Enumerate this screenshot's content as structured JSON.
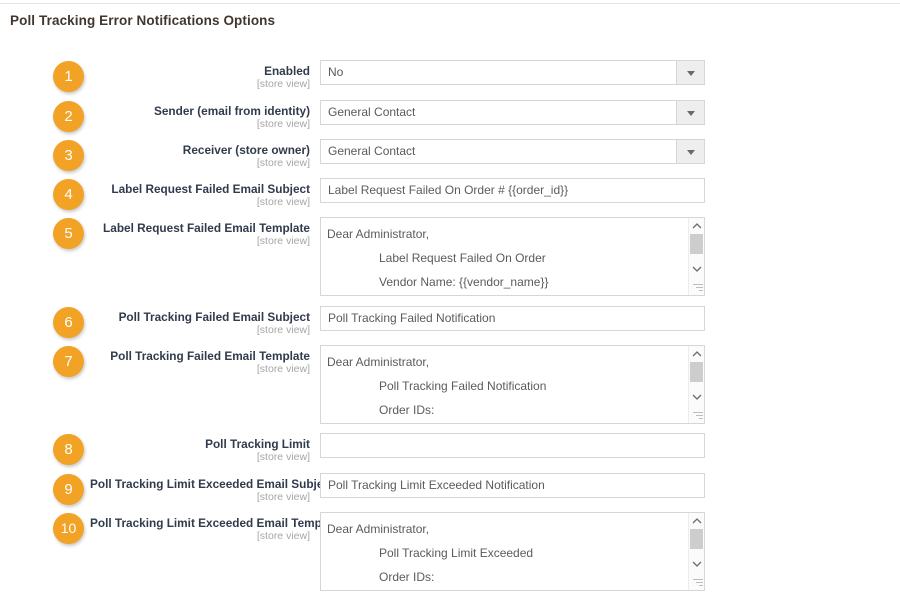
{
  "page": {
    "title": "Poll Tracking Error Notifications Options",
    "scope_label": "[store view]",
    "accent_color": "#f2a224",
    "label_color": "#303b4c",
    "border_color": "#d6d6d6"
  },
  "fields": [
    {
      "number": "1",
      "label": "Enabled",
      "scope": "[store view]",
      "type": "select",
      "value": "No"
    },
    {
      "number": "2",
      "label": "Sender (email from identity)",
      "scope": "[store view]",
      "type": "select",
      "value": "General Contact"
    },
    {
      "number": "3",
      "label": "Receiver (store owner)",
      "scope": "[store view]",
      "type": "select",
      "value": "General Contact"
    },
    {
      "number": "4",
      "label": "Label Request Failed Email Subject",
      "scope": "[store view]",
      "type": "text",
      "value": "Label Request Failed On Order # {{order_id}}"
    },
    {
      "number": "5",
      "label": "Label Request Failed Email Template",
      "scope": "[store view]",
      "type": "textarea",
      "lines": [
        "Dear Administrator,",
        "Label Request Failed On Order",
        "Vendor Name: {{vendor_name}}"
      ]
    },
    {
      "number": "6",
      "label": "Poll Tracking Failed Email Subject",
      "scope": "[store view]",
      "type": "text",
      "value": "Poll Tracking Failed Notification"
    },
    {
      "number": "7",
      "label": "Poll Tracking Failed Email Template",
      "scope": "[store view]",
      "type": "textarea",
      "lines": [
        "Dear Administrator,",
        "Poll Tracking Failed Notification",
        "Order IDs:"
      ]
    },
    {
      "number": "8",
      "label": "Poll Tracking Limit",
      "scope": "[store view]",
      "type": "text",
      "value": ""
    },
    {
      "number": "9",
      "label": "Poll Tracking Limit Exceeded Email Subject",
      "scope": "[store view]",
      "type": "text",
      "value": "Poll Tracking Limit Exceeded Notification"
    },
    {
      "number": "10",
      "label": "Poll Tracking Limit Exceeded Email Template",
      "scope": "[store view]",
      "type": "textarea",
      "lines": [
        "Dear Administrator,",
        "Poll Tracking Limit Exceeded",
        "Order IDs:"
      ]
    }
  ]
}
